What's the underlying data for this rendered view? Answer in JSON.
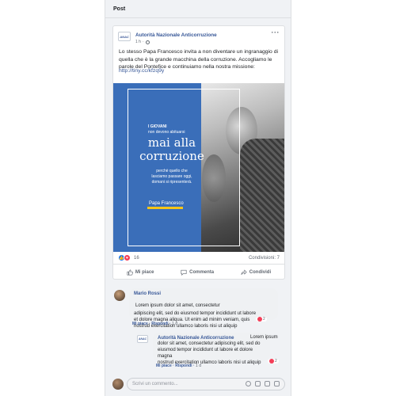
{
  "page": {
    "title": "Post"
  },
  "post": {
    "author": "Autorità Nazionale Anticorruzione",
    "logo_text": "ANAC",
    "time": "1 h",
    "text_lines": [
      "Lo stesso Papa Francesco invita a non diventare un ingranaggio di",
      "quella che è la grande macchina della corruzione. Accogliamo le",
      "parole del Pontefice e continuiamo nella nostra missione:"
    ],
    "link": "http://tiny.cc/kfzq9y",
    "image": {
      "small1": "I GIOVANI",
      "small2": "non devono abituarsi",
      "big1": "mai alla",
      "big2": "corruzione",
      "sub": [
        "perchè quello che",
        "lasciamo passare oggi,",
        "domani si ripresenterà."
      ],
      "signature": "Papa Francesco"
    },
    "reactions_count": "16",
    "shares": "Condivisioni: 7",
    "actions": {
      "like": "Mi piace",
      "comment": "Commenta",
      "share": "Condividi"
    }
  },
  "comments": [
    {
      "name": "Mario Rossi",
      "text_lines": [
        "Lorem ipsum dolor sit amet, consectetur",
        "adipiscing elit, sed do eiusmod tempor incididunt ut labore",
        "et dolore magna aliqua. Ut enim ad minim veniam, quis",
        "nostrud exercitation ullamco laboris nisi ut aliquip"
      ],
      "like": "Mi piace",
      "reply": "Rispondi",
      "time": "1 d",
      "reactions": "2"
    },
    {
      "name": "Autorità Nazionale Anticorruzione",
      "logo_text": "ANAC",
      "text_lines": [
        "Lorem ipsum",
        "dolor sit amet, consectetur adipiscing elit, sed do",
        "eiusmod tempor incididunt ut labore et dolore magna",
        "nostrud exercitation ullamco laboris nisi ut aliquip"
      ],
      "like": "Mi piace",
      "reply": "Rispondi",
      "time": "1 d",
      "reactions": "2"
    }
  ],
  "composer": {
    "placeholder": "Scrivi un commento..."
  }
}
